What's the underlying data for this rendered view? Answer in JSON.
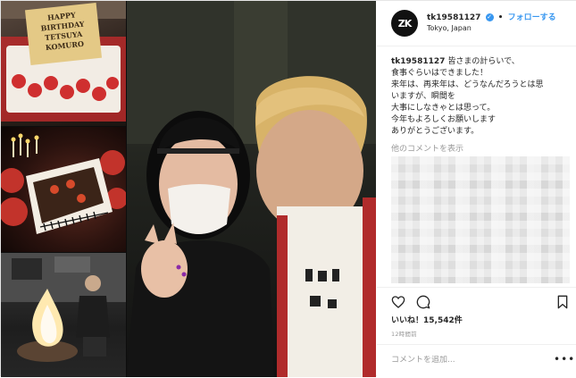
{
  "header": {
    "avatar_text": "ZK",
    "username": "tk19581127",
    "separator": "•",
    "follow_label": "フォローする",
    "location": "Tokyo, Japan"
  },
  "media": {
    "cake_label": [
      "HAPPY",
      "BIRTHDAY",
      "TETSUYA",
      "KOMURO"
    ]
  },
  "caption": {
    "username": "tk19581127",
    "lines": [
      "皆さまの計らいで、",
      "食事ぐらいはできました！",
      "来年は、再来年は、どうなんだろうとは思",
      "いますが、瞬間を",
      "大事にしなきゃとは思って。",
      "今年もよろしくお願いします",
      "ありがとうございます。"
    ]
  },
  "comments": {
    "view_more": "他のコメントを表示"
  },
  "actions": {
    "likes": "いいね！15,542件",
    "time_ago": "12時間前"
  },
  "add_comment": {
    "placeholder": "コメントを追加...",
    "more": "•••"
  },
  "colors": {
    "link_blue": "#3897f0",
    "muted_gray": "#999999",
    "text": "#262626"
  }
}
